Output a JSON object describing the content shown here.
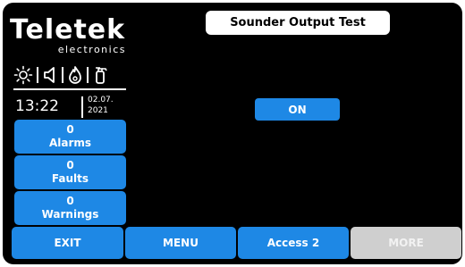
{
  "brand": {
    "name": "Teletek",
    "sub": "electronics"
  },
  "status_icons": [
    "sun-icon",
    "speaker-icon",
    "fire-icon",
    "extinguisher-icon"
  ],
  "clock": {
    "time": "13:22",
    "date_day_month": "02.07.",
    "date_year": "2021"
  },
  "counters": [
    {
      "count": "0",
      "label": "Alarms"
    },
    {
      "count": "0",
      "label": "Faults"
    },
    {
      "count": "0",
      "label": "Warnings"
    }
  ],
  "page_title": "Sounder Output Test",
  "toggle": {
    "label": "ON"
  },
  "bottom": {
    "exit": "EXIT",
    "menu": "MENU",
    "access": "Access 2",
    "more": "MORE"
  },
  "colors": {
    "accent": "#1e88e5",
    "background": "#000000",
    "disabled": "#cfcfcf"
  }
}
